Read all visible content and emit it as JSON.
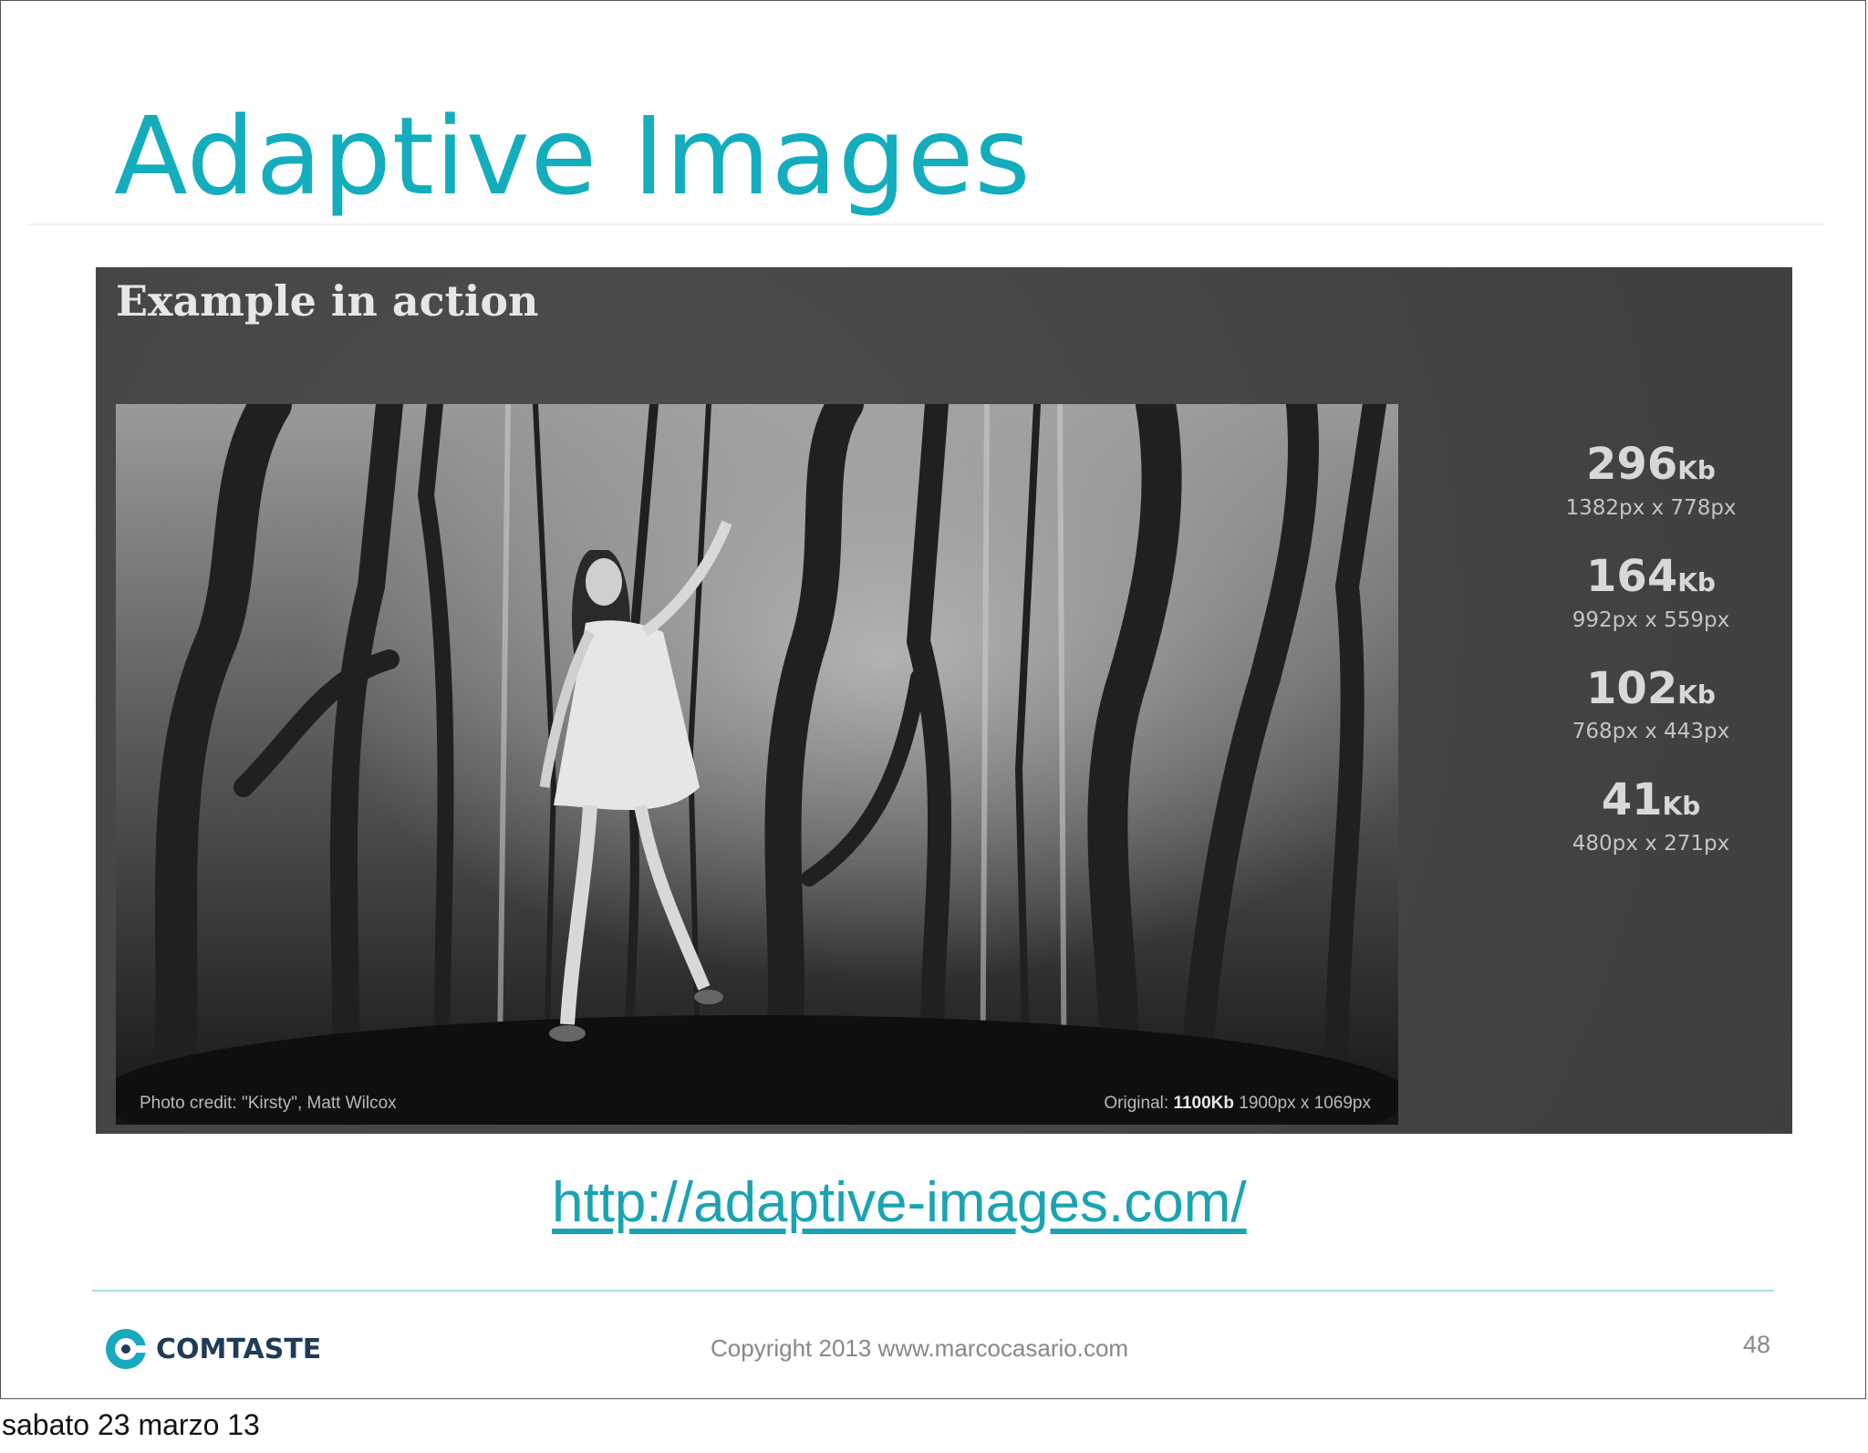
{
  "slide": {
    "title": "Adaptive Images",
    "screenshot": {
      "heading": "Example in action",
      "photo_credit": "Photo credit: \"Kirsty\", Matt Wilcox",
      "original_prefix": "Original:",
      "original_size": "1100Kb",
      "original_dims": "1900px x 1069px",
      "sizes": [
        {
          "kb": "296",
          "unit": "Kb",
          "dims": "1382px x 778px"
        },
        {
          "kb": "164",
          "unit": "Kb",
          "dims": "992px x 559px"
        },
        {
          "kb": "102",
          "unit": "Kb",
          "dims": "768px x 443px"
        },
        {
          "kb": "41",
          "unit": "Kb",
          "dims": "480px x 271px"
        }
      ]
    },
    "link": "http://adaptive-images.com/",
    "footer": {
      "logo_text": "COMTASTE",
      "copyright": "Copyright 2013 www.marcocasario.com",
      "page_number": "48"
    }
  },
  "date_caption": "sabato 23 marzo 13",
  "colors": {
    "accent": "#13adbd",
    "link": "#1aa3b2",
    "screenshot_bg": "#474747"
  }
}
